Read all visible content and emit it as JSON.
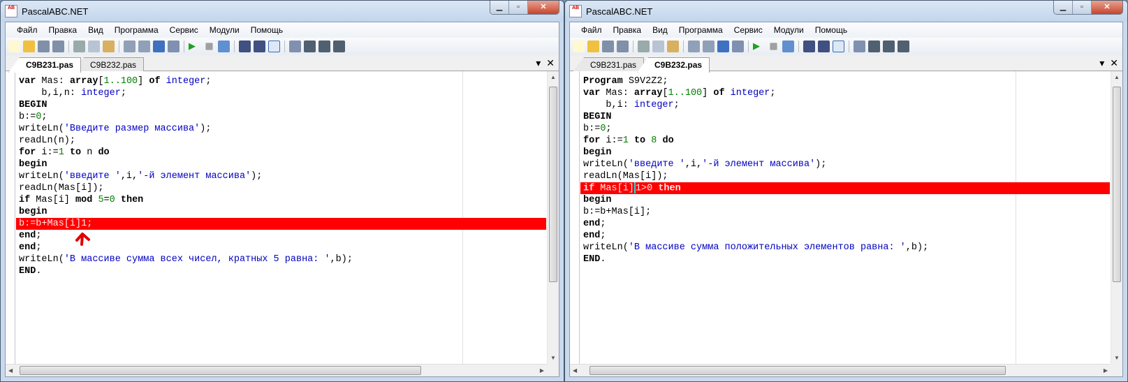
{
  "windows": [
    {
      "title": "PascalABC.NET",
      "menu": [
        "Файл",
        "Правка",
        "Вид",
        "Программа",
        "Сервис",
        "Модули",
        "Помощь"
      ],
      "tabs": [
        {
          "label": "C9B231.pas",
          "active": true
        },
        {
          "label": "C9B232.pas",
          "active": false
        }
      ],
      "error_line": 12,
      "lines": [
        [
          [
            "var",
            "k"
          ],
          [
            " Mas: ",
            "p"
          ],
          [
            "array",
            "k"
          ],
          [
            "[",
            "p"
          ],
          [
            "1..100",
            "n"
          ],
          [
            "] ",
            "p"
          ],
          [
            "of",
            "k"
          ],
          [
            " ",
            "p"
          ],
          [
            "integer",
            "t"
          ],
          [
            ";",
            "p"
          ]
        ],
        [
          [
            "    b,i,n: ",
            "p"
          ],
          [
            "integer",
            "t"
          ],
          [
            ";",
            "p"
          ]
        ],
        [
          [
            "BEGIN",
            "k"
          ]
        ],
        [
          [
            "b:=",
            "p"
          ],
          [
            "0",
            "n"
          ],
          [
            ";",
            "p"
          ]
        ],
        [
          [
            "writeLn(",
            "p"
          ],
          [
            "'Введите размер массива'",
            "s"
          ],
          [
            ");",
            "p"
          ]
        ],
        [
          [
            "readLn(n);",
            "p"
          ]
        ],
        [
          [
            "for",
            "k"
          ],
          [
            " i:=",
            "p"
          ],
          [
            "1",
            "n"
          ],
          [
            " ",
            "p"
          ],
          [
            "to",
            "k"
          ],
          [
            " n ",
            "p"
          ],
          [
            "do",
            "k"
          ]
        ],
        [
          [
            "begin",
            "k"
          ]
        ],
        [
          [
            "writeLn(",
            "p"
          ],
          [
            "'введите '",
            "s"
          ],
          [
            ",i,",
            "p"
          ],
          [
            "'-й элемент массива'",
            "s"
          ],
          [
            ");",
            "p"
          ]
        ],
        [
          [
            "readLn(Mas[i]);",
            "p"
          ]
        ],
        [
          [
            "if",
            "k"
          ],
          [
            " Mas[i] ",
            "p"
          ],
          [
            "mod",
            "k"
          ],
          [
            " ",
            "p"
          ],
          [
            "5",
            "n"
          ],
          [
            "=",
            "p"
          ],
          [
            "0",
            "n"
          ],
          [
            " ",
            "p"
          ],
          [
            "then",
            "k"
          ]
        ],
        [
          [
            "begin",
            "k"
          ]
        ],
        [
          [
            "b:=b+Mas[i]1;",
            "p"
          ]
        ],
        [
          [
            "end",
            "k"
          ],
          [
            ";",
            "p"
          ]
        ],
        [
          [
            "end",
            "k"
          ],
          [
            ";",
            "p"
          ]
        ],
        [
          [
            "writeLn(",
            "p"
          ],
          [
            "'В массиве сумма всех чисел, кратных 5 равна: '",
            "s"
          ],
          [
            ",b);",
            "p"
          ]
        ],
        [
          [
            "END",
            "k"
          ],
          [
            ".",
            "p"
          ]
        ]
      ]
    },
    {
      "title": "PascalABC.NET",
      "menu": [
        "Файл",
        "Правка",
        "Вид",
        "Программа",
        "Сервис",
        "Модули",
        "Помощь"
      ],
      "tabs": [
        {
          "label": "C9B231.pas",
          "active": false
        },
        {
          "label": "C9B232.pas",
          "active": true
        }
      ],
      "error_line": 9,
      "caret_after": 9,
      "lines": [
        [
          [
            "Program",
            "k"
          ],
          [
            " S9V2Z2;",
            "p"
          ]
        ],
        [
          [
            "var",
            "k"
          ],
          [
            " Mas: ",
            "p"
          ],
          [
            "array",
            "k"
          ],
          [
            "[",
            "p"
          ],
          [
            "1..100",
            "n"
          ],
          [
            "] ",
            "p"
          ],
          [
            "of",
            "k"
          ],
          [
            " ",
            "p"
          ],
          [
            "integer",
            "t"
          ],
          [
            ";",
            "p"
          ]
        ],
        [
          [
            "    b,i: ",
            "p"
          ],
          [
            "integer",
            "t"
          ],
          [
            ";",
            "p"
          ]
        ],
        [
          [
            "BEGIN",
            "k"
          ]
        ],
        [
          [
            "b:=",
            "p"
          ],
          [
            "0",
            "n"
          ],
          [
            ";",
            "p"
          ]
        ],
        [
          [
            "for",
            "k"
          ],
          [
            " i:=",
            "p"
          ],
          [
            "1",
            "n"
          ],
          [
            " ",
            "p"
          ],
          [
            "to",
            "k"
          ],
          [
            " ",
            "p"
          ],
          [
            "8",
            "n"
          ],
          [
            " ",
            "p"
          ],
          [
            "do",
            "k"
          ]
        ],
        [
          [
            "begin",
            "k"
          ]
        ],
        [
          [
            "writeLn(",
            "p"
          ],
          [
            "'введите '",
            "s"
          ],
          [
            ",i,",
            "p"
          ],
          [
            "'-й элемент массива'",
            "s"
          ],
          [
            ");",
            "p"
          ]
        ],
        [
          [
            "readLn(Mas[i]);",
            "p"
          ]
        ],
        [
          [
            "if",
            "k"
          ],
          [
            " Mas[i]",
            "p"
          ],
          [
            "1>0 ",
            "p"
          ],
          [
            "then",
            "k"
          ]
        ],
        [
          [
            "begin",
            "k"
          ]
        ],
        [
          [
            "b:=b+Mas[i];",
            "p"
          ]
        ],
        [
          [
            "end",
            "k"
          ],
          [
            ";",
            "p"
          ]
        ],
        [
          [
            "end",
            "k"
          ],
          [
            ";",
            "p"
          ]
        ],
        [
          [
            "writeLn(",
            "p"
          ],
          [
            "'В массиве сумма положительных элементов равна: '",
            "s"
          ],
          [
            ",b);",
            "p"
          ]
        ],
        [
          [
            "END",
            "k"
          ],
          [
            ".",
            "p"
          ]
        ]
      ]
    }
  ],
  "toolbar_icons": [
    "new-file",
    "open",
    "save",
    "save-all",
    "sep",
    "cut",
    "copy",
    "paste",
    "sep",
    "undo",
    "redo",
    "indent",
    "unindent",
    "sep",
    "run",
    "stop",
    "compile",
    "sep",
    "step-into",
    "step-over",
    "output-window",
    "sep",
    "form",
    "debug-d",
    "debug-l",
    "debug-r"
  ],
  "colors": {
    "error_line": "#ff0000",
    "annotation": "#e00000",
    "caret": "#3ad0d0"
  }
}
